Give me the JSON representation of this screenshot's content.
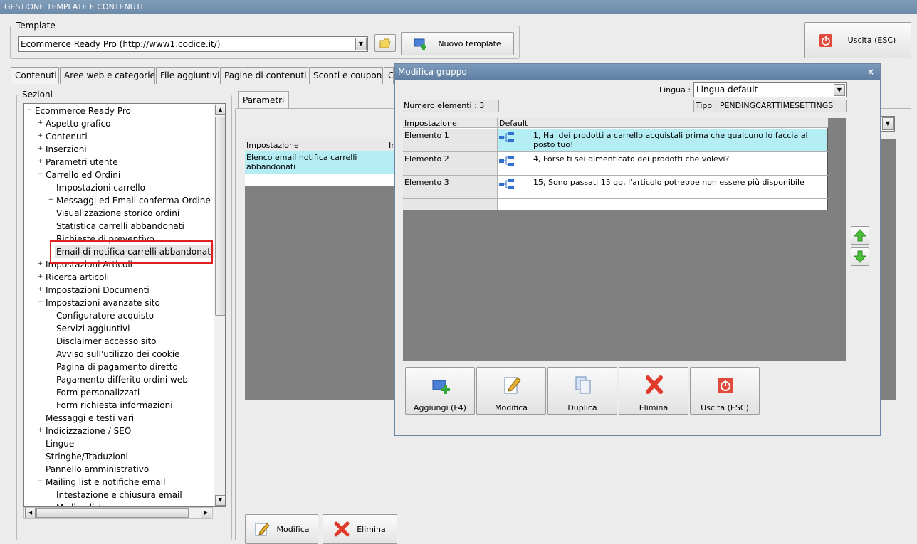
{
  "window": {
    "title": "GESTIONE TEMPLATE E CONTENUTI"
  },
  "template": {
    "group_label": "Template",
    "selected": "Ecommerce Ready Pro (http://www1.codice.it/)",
    "new_template_label": "Nuovo template",
    "exit_label": "Uscita (ESC)"
  },
  "tabs": [
    "Contenuti",
    "Aree web e categorie",
    "File aggiuntivi",
    "Pagine di contenuti",
    "Sconti e coupon",
    "G"
  ],
  "sections": {
    "label": "Sezioni",
    "items": [
      "Ecommerce Ready Pro",
      "Aspetto grafico",
      "Contenuti",
      "Inserzioni",
      "Parametri utente",
      "Carrello ed Ordini",
      "Impostazioni carrello",
      "Messaggi ed Email conferma Ordine",
      "Visualizzazione storico ordini",
      "Statistica carrelli abbandonati",
      "Richieste di preventivo",
      "Email di notifica carrelli abbandonati",
      "Impostazioni Articoli",
      "Ricerca articoli",
      "Impostazioni Documenti",
      "Impostazioni avanzate sito",
      "Configuratore acquisto",
      "Servizi aggiuntivi",
      "Disclaimer accesso sito",
      "Avviso sull'utilizzo dei cookie",
      "Pagina di pagamento diretto",
      "Pagamento differito ordini web",
      "Form personalizzati",
      "Form richiesta informazioni",
      "Messaggi e testi vari",
      "Indicizzazione / SEO",
      "Lingue",
      "Stringhe/Traduzioni",
      "Pannello amministrativo",
      "Mailing list e notifiche email",
      "Intestazione e chiusura email",
      "Mailing list"
    ]
  },
  "params": {
    "tab_label": "Parametri",
    "col_impostazione": "Impostazione",
    "col_second": "In",
    "row1": "Elenco email notifica carrelli abbandonati",
    "modifica_label": "Modifica",
    "elimina_label": "Elimina"
  },
  "dialog": {
    "title": "Modifica gruppo",
    "close": "×",
    "lingua_label": "Lingua :",
    "lingua_value": "Lingua default",
    "tipo": "Tipo : PENDINGCARTTIMESETTINGS",
    "count": "Numero elementi : 3",
    "col_impostazione": "Impostazione",
    "col_default": "Default",
    "rows": [
      {
        "name": "Elemento 1",
        "value": "1, Hai dei prodotti a carrello acquistali prima che qualcuno lo faccia al posto tuo!"
      },
      {
        "name": "Elemento 2",
        "value": "4, Forse ti sei dimenticato dei prodotti che volevi?"
      },
      {
        "name": "Elemento 3",
        "value": "15, Sono passati 15 gg, l'articolo potrebbe non essere più disponibile"
      }
    ],
    "buttons": {
      "aggiungi": "Aggiungi (F4)",
      "modifica": "Modifica",
      "duplica": "Duplica",
      "elimina": "Elimina",
      "uscita": "Uscita (ESC)"
    }
  },
  "colors": {
    "title_bar": "#6d8aa8",
    "selected_row": "#b4eef4",
    "highlight_border": "#e02020",
    "grid_background": "#808080"
  }
}
